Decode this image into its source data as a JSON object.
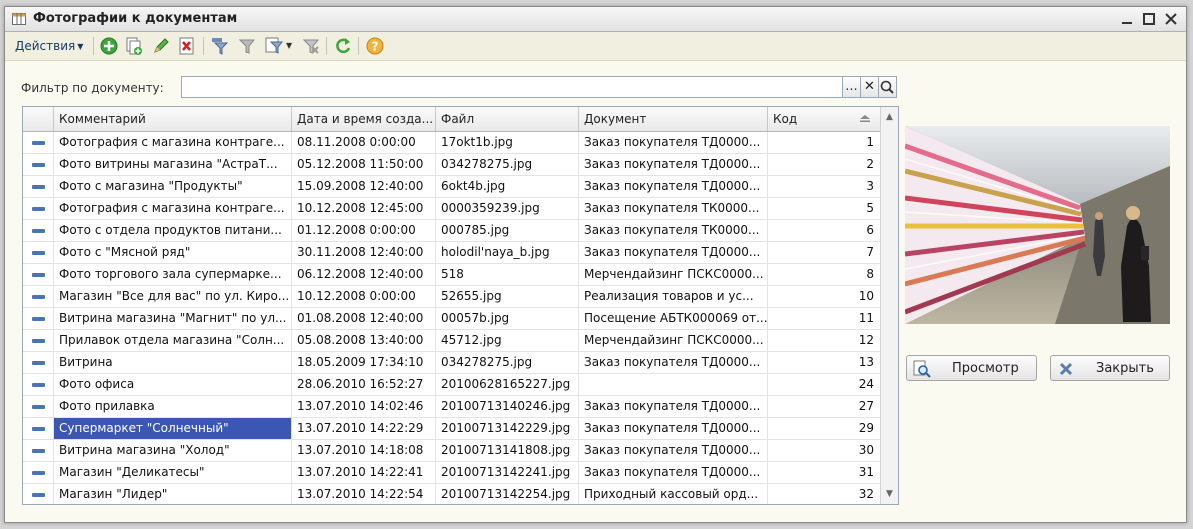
{
  "window": {
    "title": "Фотографии к документам",
    "controls": [
      "minimize",
      "maximize",
      "close"
    ]
  },
  "toolbar": {
    "actions_label": "Действия",
    "icons": [
      "add-icon",
      "copy-icon",
      "edit-icon",
      "delete-icon",
      "filter-icon",
      "filter-clear-icon",
      "filter-list-icon",
      "filter-off-icon",
      "refresh-icon",
      "help-icon"
    ]
  },
  "filter": {
    "label": "Фильтр по документу:",
    "value": "",
    "select_button": "...",
    "clear_button": "✕"
  },
  "table": {
    "columns": [
      "Комментарий",
      "Дата и время созда...",
      "Файл",
      "Документ",
      "Код"
    ],
    "rows": [
      {
        "comment": "Фотография с магазина контраге...",
        "date": "08.11.2008 0:00:00",
        "file": "17okt1b.jpg",
        "document": "Заказ покупателя ТД0000...",
        "code": "1"
      },
      {
        "comment": "Фото витрины магазина \"АстраТ...",
        "date": "05.12.2008 11:50:00",
        "file": "034278275.jpg",
        "document": "Заказ покупателя ТД0000...",
        "code": "2"
      },
      {
        "comment": "Фото с магазина \"Продукты\"",
        "date": "15.09.2008 12:40:00",
        "file": "6okt4b.jpg",
        "document": "Заказ покупателя ТД0000...",
        "code": "3"
      },
      {
        "comment": "Фотография с магазина контраге...",
        "date": "10.12.2008 12:45:00",
        "file": "0000359239.jpg",
        "document": "Заказ покупателя ТК0000...",
        "code": "5"
      },
      {
        "comment": "Фото с отдела  продуктов питани...",
        "date": "01.12.2008 0:00:00",
        "file": "000785.jpg",
        "document": "Заказ покупателя ТК0000...",
        "code": "6"
      },
      {
        "comment": "Фото с \"Мясной ряд\"",
        "date": "30.11.2008 12:40:00",
        "file": "holodil'naya_b.jpg",
        "document": "Заказ покупателя ТД0000...",
        "code": "7"
      },
      {
        "comment": "Фото торгового зала супермарке...",
        "date": "06.12.2008 12:40:00",
        "file": "518",
        "document": "Мерчендайзинг ПСКС0000...",
        "code": "8"
      },
      {
        "comment": "Магазин \"Все для вас\" по ул. Киро...",
        "date": "10.12.2008 0:00:00",
        "file": "52655.jpg",
        "document": "Реализация товаров и ус...",
        "code": "10"
      },
      {
        "comment": "Витрина магазина \"Магнит\" по ул...",
        "date": "01.08.2008 12:40:00",
        "file": "00057b.jpg",
        "document": "Посещение АБТК000069 от...",
        "code": "11"
      },
      {
        "comment": "Прилавок отдела магазина \"Солн...",
        "date": "05.08.2008 13:40:00",
        "file": "45712.jpg",
        "document": "Мерчендайзинг ПСКС0000...",
        "code": "12"
      },
      {
        "comment": "Витрина",
        "date": "18.05.2009 17:34:10",
        "file": "034278275.jpg",
        "document": "Заказ покупателя ТД0000...",
        "code": "13"
      },
      {
        "comment": "Фото офиса",
        "date": "28.06.2010 16:52:27",
        "file": "20100628165227.jpg",
        "document": "",
        "code": "24"
      },
      {
        "comment": "Фото прилавка",
        "date": "13.07.2010 14:02:46",
        "file": "20100713140246.jpg",
        "document": "Заказ покупателя ТД0000...",
        "code": "27"
      },
      {
        "comment": "Супермаркет \"Солнечный\"",
        "date": "13.07.2010 14:22:29",
        "file": "20100713142229.jpg",
        "document": "Заказ покупателя ТД0000...",
        "code": "29",
        "selected": true
      },
      {
        "comment": "Витрина магазина \"Холод\"",
        "date": "13.07.2010 14:18:08",
        "file": "20100713141808.jpg",
        "document": "Заказ покупателя ТД0000...",
        "code": "30"
      },
      {
        "comment": "Магазин \"Деликатесы\"",
        "date": "13.07.2010 14:22:41",
        "file": "20100713142241.jpg",
        "document": "Заказ покупателя ТД0000...",
        "code": "31"
      },
      {
        "comment": "Магазин \"Лидер\"",
        "date": "13.07.2010 14:22:54",
        "file": "20100713142254.jpg",
        "document": "Приходный кассовый орд...",
        "code": "32"
      }
    ]
  },
  "preview": {
    "view_button": "Просмотр",
    "close_button": "Закрыть"
  },
  "colors": {
    "selection": "#3b57b3",
    "row_marker": "#4b74b3",
    "window_bg": "#fbfaf0"
  }
}
